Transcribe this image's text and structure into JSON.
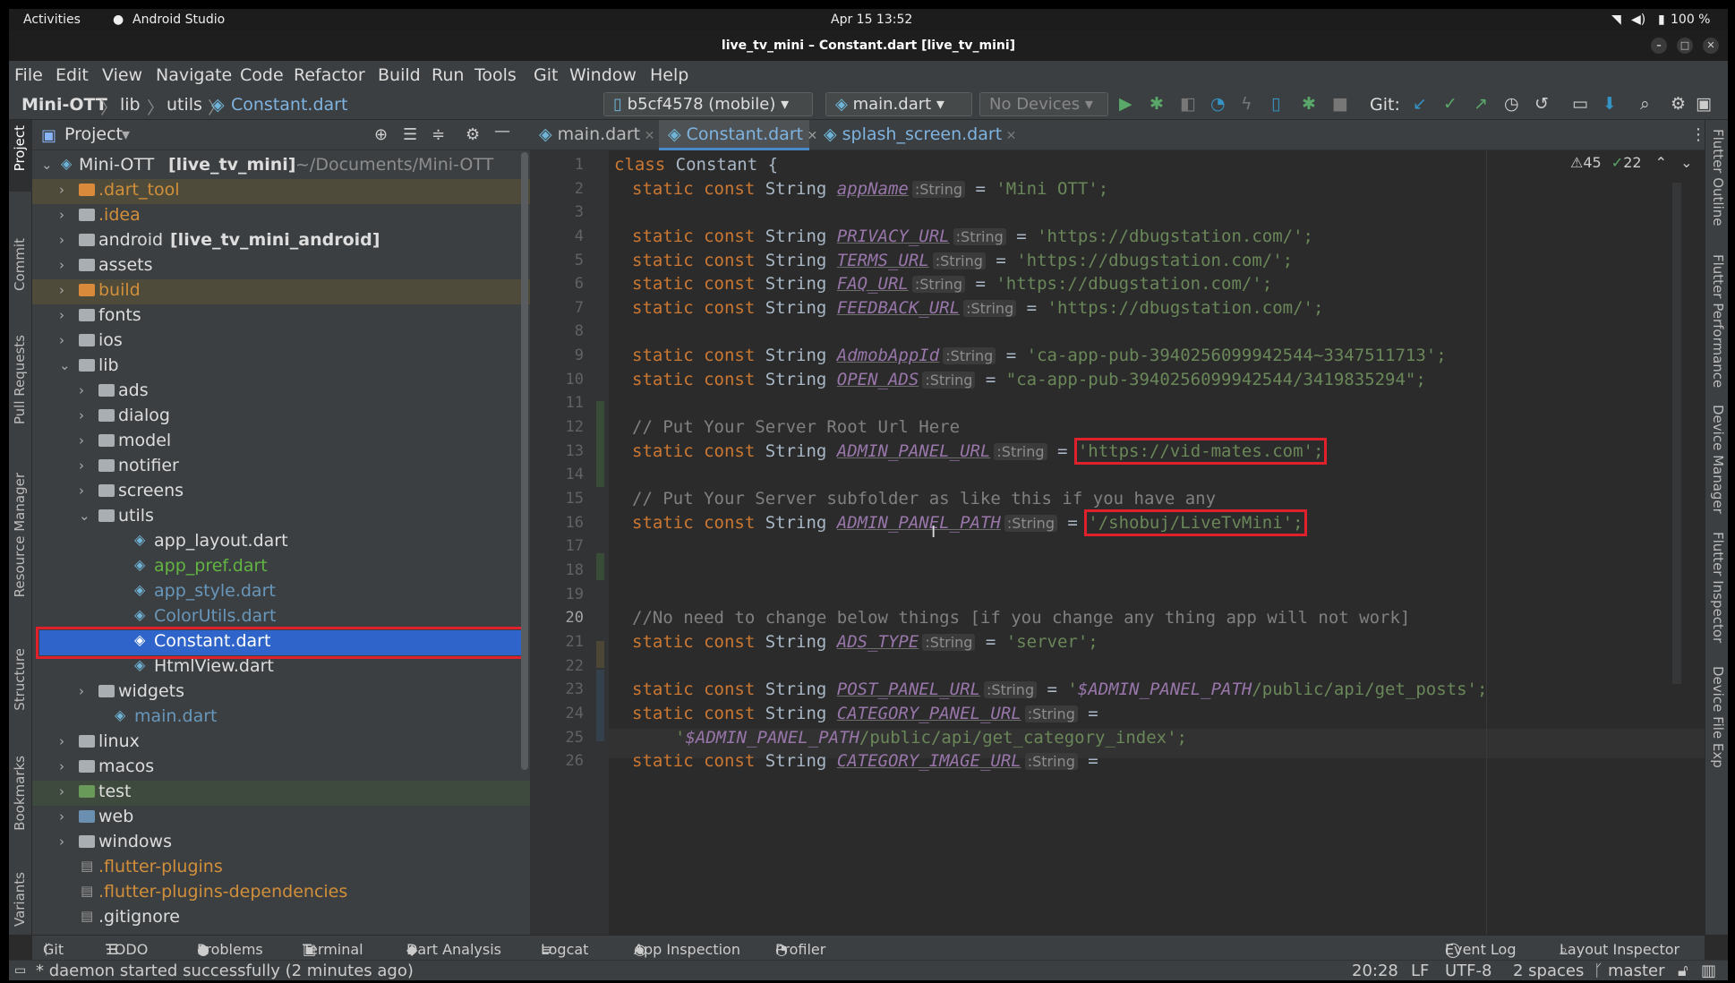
{
  "system_bar": {
    "activities": "Activities",
    "app": "Android Studio",
    "clock": "Apr 15  13:52",
    "battery": "100 %"
  },
  "window": {
    "title": "live_tv_mini – Constant.dart [live_tv_mini]"
  },
  "menu": [
    "File",
    "Edit",
    "View",
    "Navigate",
    "Code",
    "Refactor",
    "Build",
    "Run",
    "Tools",
    "Git",
    "Window",
    "Help"
  ],
  "breadcrumb": {
    "project": "Mini-OTT",
    "lib": "lib",
    "utils": "utils",
    "file": "Constant.dart"
  },
  "toolbar": {
    "device": "b5cf4578 (mobile)",
    "run_config": "main.dart",
    "no_devices": "No Devices",
    "git_label": "Git:"
  },
  "project_panel": {
    "title": "Project",
    "root": {
      "name": "Mini-OTT",
      "module": "[live_tv_mini]",
      "path": "~/Documents/Mini-OTT"
    },
    "items": [
      {
        "label": ".dart_tool",
        "extra": ""
      },
      {
        "label": ".idea",
        "extra": ""
      },
      {
        "label": "android",
        "extra": "[live_tv_mini_android]"
      },
      {
        "label": "assets",
        "extra": ""
      },
      {
        "label": "build",
        "extra": ""
      },
      {
        "label": "fonts",
        "extra": ""
      },
      {
        "label": "ios",
        "extra": ""
      },
      {
        "label": "lib",
        "extra": ""
      },
      {
        "label": "ads",
        "extra": ""
      },
      {
        "label": "dialog",
        "extra": ""
      },
      {
        "label": "model",
        "extra": ""
      },
      {
        "label": "notifier",
        "extra": ""
      },
      {
        "label": "screens",
        "extra": ""
      },
      {
        "label": "utils",
        "extra": ""
      },
      {
        "label": "app_layout.dart",
        "extra": ""
      },
      {
        "label": "app_pref.dart",
        "extra": ""
      },
      {
        "label": "app_style.dart",
        "extra": ""
      },
      {
        "label": "ColorUtils.dart",
        "extra": ""
      },
      {
        "label": "Constant.dart",
        "extra": ""
      },
      {
        "label": "HtmlView.dart",
        "extra": ""
      },
      {
        "label": "widgets",
        "extra": ""
      },
      {
        "label": "main.dart",
        "extra": ""
      },
      {
        "label": "linux",
        "extra": ""
      },
      {
        "label": "macos",
        "extra": ""
      },
      {
        "label": "test",
        "extra": ""
      },
      {
        "label": "web",
        "extra": ""
      },
      {
        "label": "windows",
        "extra": ""
      },
      {
        "label": ".flutter-plugins",
        "extra": ""
      },
      {
        "label": ".flutter-plugins-dependencies",
        "extra": ""
      },
      {
        "label": ".gitignore",
        "extra": ""
      }
    ]
  },
  "editor_tabs": [
    "main.dart",
    "Constant.dart",
    "splash_screen.dart"
  ],
  "inspections": {
    "warnings": "45",
    "ok": "22"
  },
  "code": {
    "l1_class": "class",
    "l1_name": " Constant {",
    "static_const": "static const ",
    "string_type": "String ",
    "hint": ":String",
    "l2_name": "appName",
    "l2_val": "'Mini OTT';",
    "l4_name": "PRIVACY_URL",
    "l4_val": "'https://dbugstation.com/';",
    "l5_name": "TERMS_URL",
    "l5_val": "'https://dbugstation.com/';",
    "l6_name": "FAQ_URL",
    "l6_val": "'https://dbugstation.com/';",
    "l7_name": "FEEDBACK_URL",
    "l7_val": "'https://dbugstation.com/';",
    "l9_name": "AdmobAppId",
    "l9_val": "'ca-app-pub-3940256099942544~3347511713';",
    "l10_name": "OPEN_ADS",
    "l10_val": "\"ca-app-pub-3940256099942544/3419835294\";",
    "l12": "// Put Your Server Root Url Here",
    "l13_name": "ADMIN_PANEL_URL",
    "l13_val": "'https://vid-mates.com';",
    "l15": "// Put Your Server subfolder as like this if you have any",
    "l16_name": "ADMIN_PANEL_PATH",
    "l16_val": "'/shobuj/LiveTvMini';",
    "l20": "//No need to change below things [if you change any thing app will not work]",
    "l21_name": "ADS_TYPE",
    "l21_val": "'server';",
    "l23_name": "POST_PANEL_URL",
    "l23_q": "'",
    "l23_var": "$ADMIN_PANEL_PATH",
    "l23_val": "/public/api/get_posts';",
    "l24_name": "CATEGORY_PANEL_URL",
    "l25_q": "'",
    "l25_var": "$ADMIN_PANEL_PATH",
    "l25_val": "/public/api/get_category_index';",
    "l26_name": "CATEGORY_IMAGE_URL",
    "eq": " = "
  },
  "line_numbers": [
    "1",
    "2",
    "3",
    "4",
    "5",
    "6",
    "7",
    "8",
    "9",
    "10",
    "11",
    "12",
    "13",
    "14",
    "15",
    "16",
    "17",
    "18",
    "19",
    "20",
    "21",
    "22",
    "23",
    "24",
    "25",
    "26"
  ],
  "left_tool_tabs": [
    "Project",
    "Commit",
    "Pull Requests",
    "Resource Manager",
    "Structure",
    "Bookmarks",
    "Variants"
  ],
  "right_tool_tabs": [
    "Flutter Outline",
    "Flutter Performance",
    "Device Manager",
    "Flutter Inspector",
    "Device File Exp"
  ],
  "bottom_tools": [
    "Git",
    "TODO",
    "Problems",
    "Terminal",
    "Dart Analysis",
    "Logcat",
    "App Inspection",
    "Profiler",
    "Event Log",
    "Layout Inspector"
  ],
  "status": {
    "message": "* daemon started successfully (2 minutes ago)",
    "position": "20:28",
    "line_sep": "LF",
    "encoding": "UTF-8",
    "indent": "2 spaces",
    "branch": "master"
  }
}
